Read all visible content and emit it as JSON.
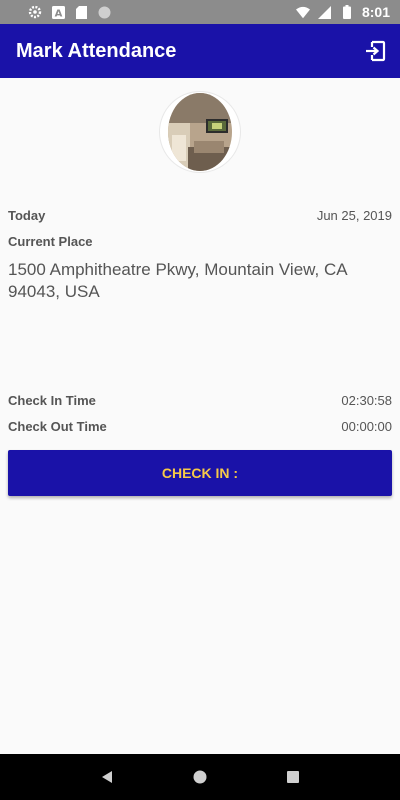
{
  "status_bar": {
    "time": "8:01",
    "left_icons": [
      "settings-icon",
      "font-a-icon",
      "sd-card-icon",
      "circle-icon"
    ],
    "right_icons": [
      "wifi-icon",
      "signal-icon",
      "battery-icon"
    ]
  },
  "app_bar": {
    "title": "Mark Attendance",
    "action_icon": "logout-icon",
    "color": "#1a12a8"
  },
  "details": {
    "today_label": "Today",
    "today_value": "Jun 25, 2019",
    "place_label": "Current Place",
    "address": "1500 Amphitheatre Pkwy, Mountain View, CA 94043, USA",
    "check_in_label": "Check In Time",
    "check_in_value": "02:30:58",
    "check_out_label": "Check Out Time",
    "check_out_value": "00:00:00"
  },
  "action_button": {
    "label": "CHECK IN :",
    "background": "#1a12a8",
    "text_color": "#f7c948"
  },
  "nav_bar": {
    "icons": [
      "back-icon",
      "home-icon",
      "recents-icon"
    ]
  }
}
